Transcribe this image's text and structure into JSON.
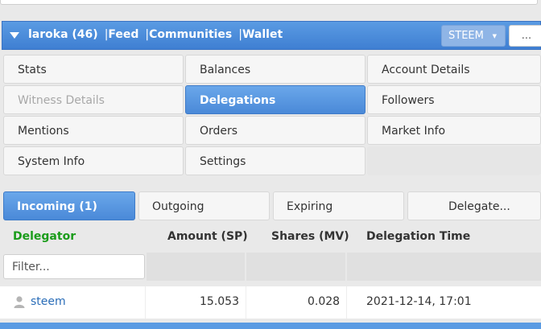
{
  "header": {
    "account": "laroka (46)",
    "nav": [
      "Feed",
      "Communities",
      "Wallet"
    ],
    "separator": "|",
    "currency": "STEEM",
    "more_label": "..."
  },
  "menu": {
    "items": [
      {
        "label": "Stats",
        "state": "normal"
      },
      {
        "label": "Balances",
        "state": "normal"
      },
      {
        "label": "Account Details",
        "state": "normal"
      },
      {
        "label": "Witness Details",
        "state": "disabled"
      },
      {
        "label": "Delegations",
        "state": "active"
      },
      {
        "label": "Followers",
        "state": "normal"
      },
      {
        "label": "Mentions",
        "state": "normal"
      },
      {
        "label": "Orders",
        "state": "normal"
      },
      {
        "label": "Market Info",
        "state": "normal"
      },
      {
        "label": "System Info",
        "state": "normal"
      },
      {
        "label": "Settings",
        "state": "normal"
      }
    ]
  },
  "tabs": {
    "incoming": "Incoming (1)",
    "outgoing": "Outgoing",
    "expiring": "Expiring",
    "delegate": "Delegate..."
  },
  "table": {
    "headers": [
      "Delegator",
      "Amount (SP)",
      "Shares (MV)",
      "Delegation Time"
    ],
    "filter_placeholder": "Filter...",
    "rows": [
      {
        "delegator": "steem",
        "amount": "15.053",
        "shares": "0.028",
        "time": "2021-12-14, 17:01"
      }
    ]
  },
  "colors": {
    "accent": "#4a89d8",
    "delegator_header": "#1a9c1a",
    "link": "#2a6db8"
  },
  "icons": {
    "header_toggle": "caret-down-icon",
    "currency_dropdown": "chevron-down-icon",
    "user": "user-icon"
  }
}
